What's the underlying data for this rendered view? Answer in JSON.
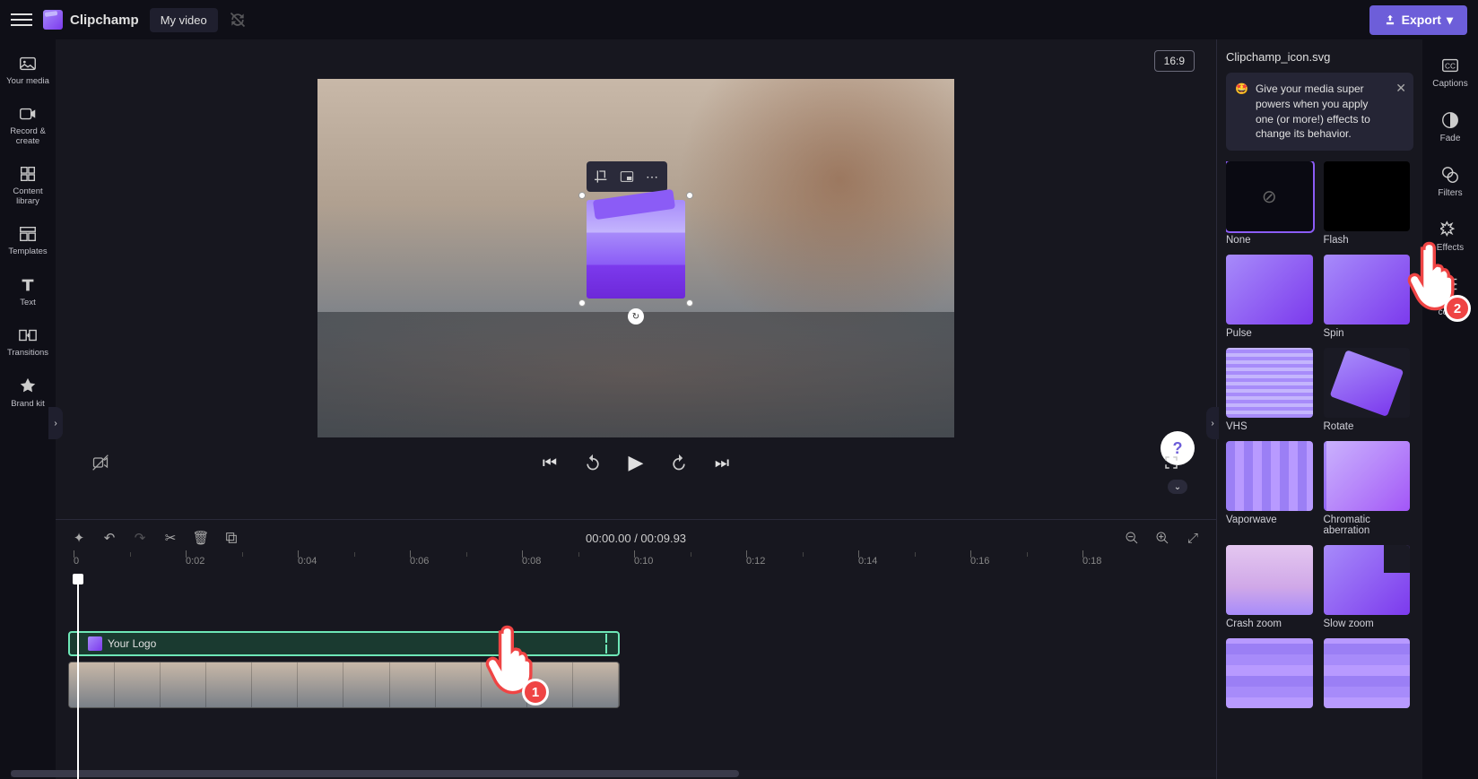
{
  "header": {
    "brand": "Clipchamp",
    "video_name": "My video",
    "export_label": "Export"
  },
  "left_sidebar": {
    "items": [
      {
        "label": "Your media"
      },
      {
        "label": "Record & create"
      },
      {
        "label": "Content library"
      },
      {
        "label": "Templates"
      },
      {
        "label": "Text"
      },
      {
        "label": "Transitions"
      },
      {
        "label": "Brand kit"
      }
    ]
  },
  "preview": {
    "aspect": "16:9"
  },
  "playback": {
    "current_time": "00:00.00",
    "duration": "00:09.93",
    "separator": " / "
  },
  "timeline": {
    "ticks": [
      "0",
      "0:02",
      "0:04",
      "0:06",
      "0:08",
      "0:10",
      "0:12",
      "0:14",
      "0:16",
      "0:18"
    ],
    "overlay_clip_label": "Your Logo"
  },
  "right_panel": {
    "title": "Clipchamp_icon.svg",
    "tip_emoji": "🤩",
    "tip_text": "Give your media super powers when you apply one (or more!) effects to change its behavior.",
    "effects": [
      {
        "label": "None",
        "thumb": "none",
        "selected": true
      },
      {
        "label": "Flash",
        "thumb": "flash"
      },
      {
        "label": "Pulse",
        "thumb": "pulse"
      },
      {
        "label": "Spin",
        "thumb": "spin"
      },
      {
        "label": "VHS",
        "thumb": "vhs"
      },
      {
        "label": "Rotate",
        "thumb": "rotate"
      },
      {
        "label": "Vaporwave",
        "thumb": "vapor"
      },
      {
        "label": "Chromatic aberration",
        "thumb": "chroma"
      },
      {
        "label": "Crash zoom",
        "thumb": "crash"
      },
      {
        "label": "Slow zoom",
        "thumb": "slow"
      },
      {
        "label": "",
        "thumb": "zoom"
      },
      {
        "label": "",
        "thumb": "zoom"
      }
    ]
  },
  "right_sidebar": {
    "items": [
      {
        "label": "Captions"
      },
      {
        "label": "Fade"
      },
      {
        "label": "Filters"
      },
      {
        "label": "Effects",
        "active": true
      },
      {
        "label": "Adjust colors"
      }
    ]
  },
  "annotations": {
    "badge1": "1",
    "badge2": "2"
  }
}
